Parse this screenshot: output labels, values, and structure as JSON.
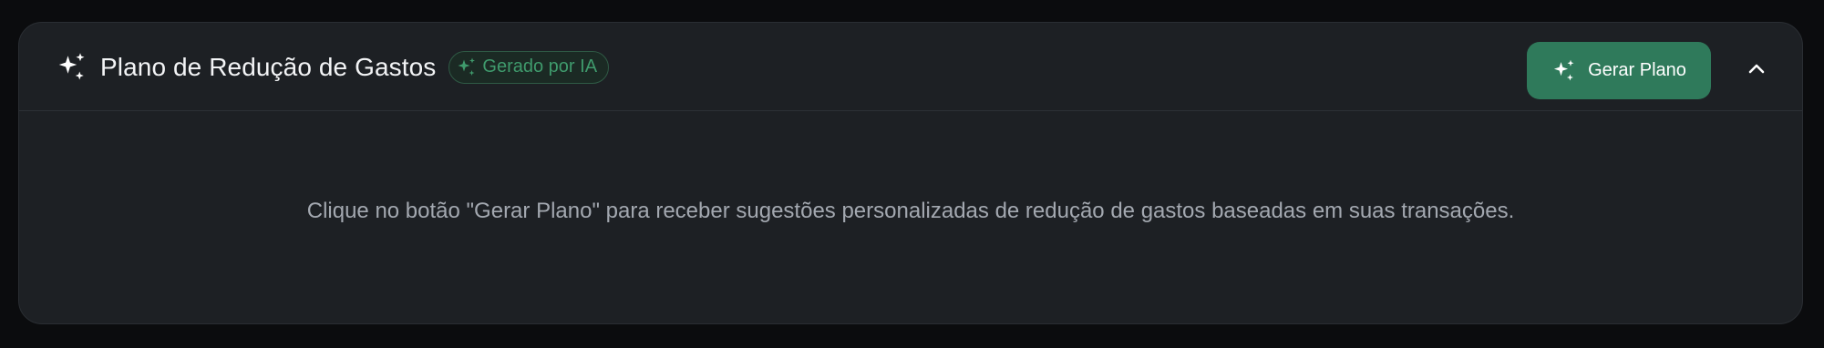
{
  "panel": {
    "title": "Plano de Redução de Gastos",
    "title_icon": "sparkles-icon",
    "badge": {
      "label": "Gerado por IA",
      "icon": "sparkles-icon",
      "color": "#3f9a6c"
    },
    "generate_button": {
      "label": "Gerar Plano",
      "icon": "sparkles-icon",
      "color": "#2f7a5b"
    },
    "collapse_icon": "chevron-up-icon",
    "empty_message": "Clique no botão \"Gerar Plano\" para receber sugestões personalizadas de redução de gastos baseadas em suas transações."
  }
}
